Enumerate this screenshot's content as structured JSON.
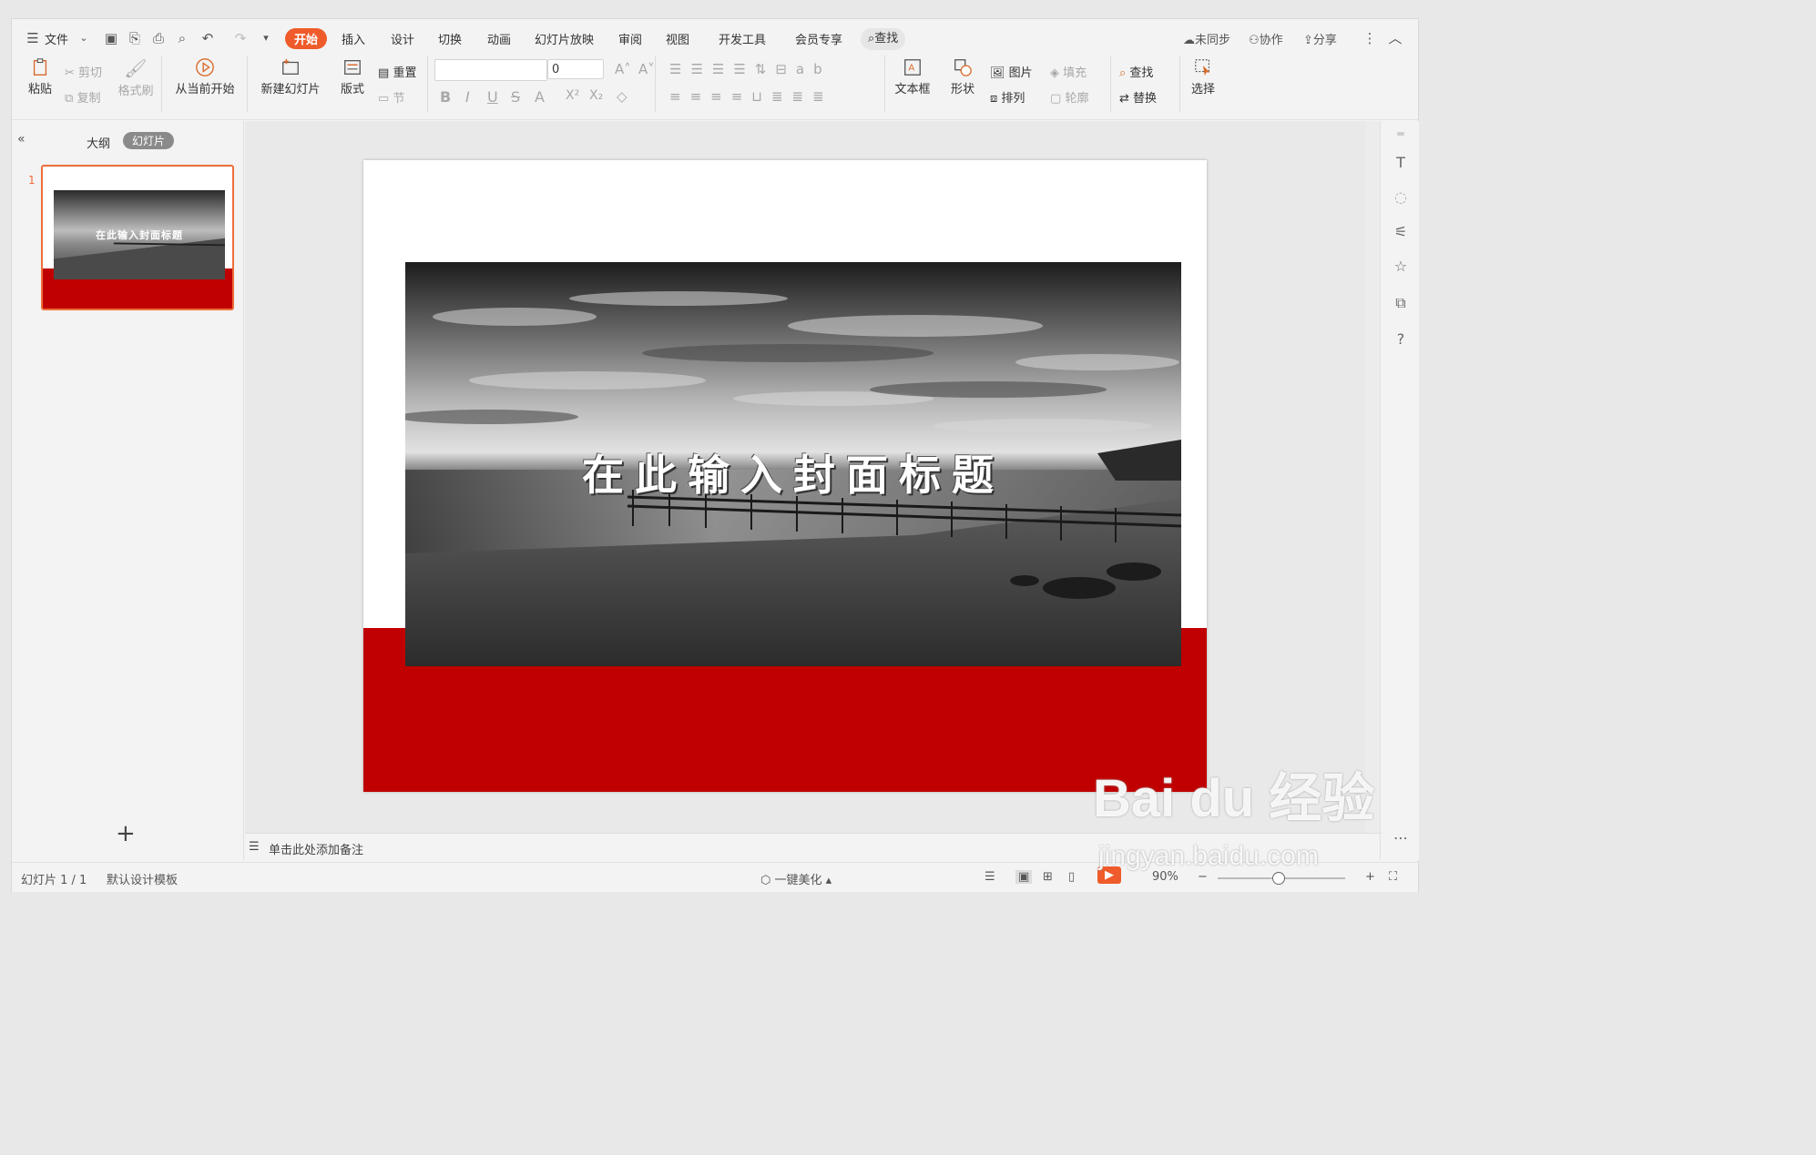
{
  "menubar": {
    "file": "文件",
    "tabs": [
      "开始",
      "插入",
      "设计",
      "切换",
      "动画",
      "幻灯片放映",
      "审阅",
      "视图",
      "开发工具",
      "会员专享"
    ],
    "search": "查找",
    "right": [
      "未同步",
      "协作",
      "分享"
    ]
  },
  "ribbon": {
    "paste": "粘贴",
    "cut": "剪切",
    "copy": "复制",
    "format_painter": "格式刷",
    "from_current": "从当前开始",
    "new_slide": "新建幻灯片",
    "layout": "版式",
    "reset": "重置",
    "section": "节",
    "font_size": "0",
    "textbox": "文本框",
    "shape": "形状",
    "picture": "图片",
    "fill": "填充",
    "arrange": "排列",
    "outline": "轮廓",
    "find": "查找",
    "replace": "替换",
    "select": "选择"
  },
  "leftpanel": {
    "outline_tab": "大纲",
    "slides_tab": "幻灯片",
    "slide_number": "1",
    "thumb_title": "在此输入封面标题"
  },
  "slide": {
    "title": "在此输入封面标题"
  },
  "notes": {
    "placeholder": "单击此处添加备注"
  },
  "status": {
    "slide_counter": "幻灯片 1 / 1",
    "template": "默认设计模板",
    "beautify": "一键美化",
    "zoom": "90%"
  },
  "watermark": {
    "brand": "Bai du 经验",
    "url": "jingyan.baidu.com"
  },
  "colors": {
    "accent": "#ef5b2a",
    "slide_red": "#c00000"
  }
}
